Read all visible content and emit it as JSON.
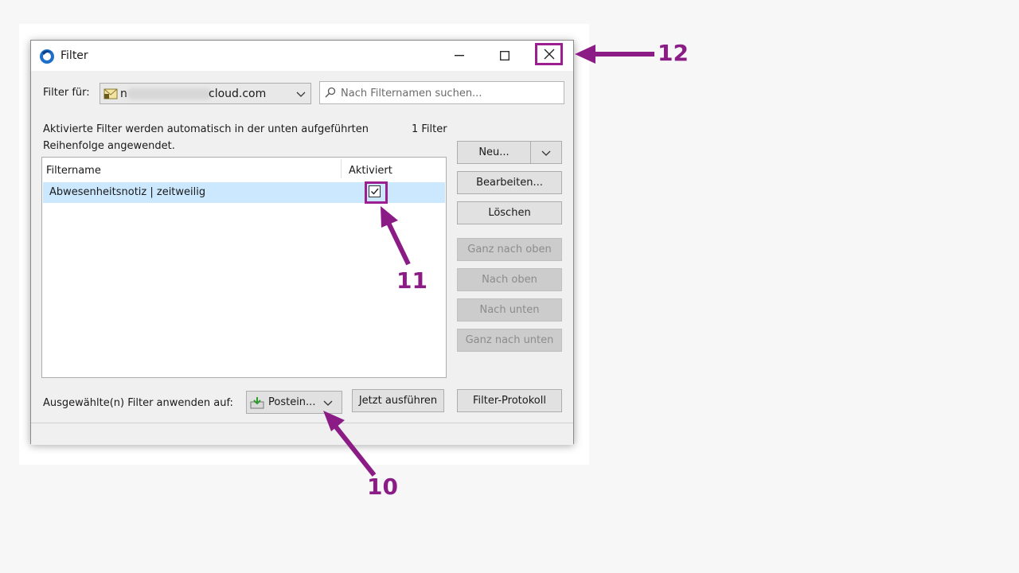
{
  "window": {
    "title": "Filter",
    "minimize_icon": "minimize-icon",
    "maximize_icon": "maximize-icon",
    "close_icon": "close-icon"
  },
  "filter_for": {
    "label": "Filter für:",
    "account_value": "n",
    "account_suffix": "cloud.com"
  },
  "search": {
    "placeholder": "Nach Filternamen suchen..."
  },
  "description": {
    "line1": "Aktivierte Filter werden automatisch in der unten aufgeführten",
    "line2": "Reihenfolge angewendet.",
    "count": "1 Filter"
  },
  "table": {
    "columns": [
      "Filtername",
      "Aktiviert"
    ],
    "rows": [
      {
        "name": "Abwesenheitsnotiz | zeitweilig",
        "enabled": true
      }
    ]
  },
  "buttons": {
    "new": "Neu...",
    "edit": "Bearbeiten...",
    "delete": "Löschen",
    "top": "Ganz nach oben",
    "up": "Nach oben",
    "down": "Nach unten",
    "bottom": "Ganz nach unten",
    "run_now": "Jetzt ausführen",
    "filter_log": "Filter-Protokoll"
  },
  "apply": {
    "label": "Ausgewählte(n) Filter anwenden auf:",
    "folder": "Postein..."
  },
  "annotations": [
    "10",
    "11",
    "12"
  ],
  "colors": {
    "accent": "#8b1c86",
    "selection": "#cce8ff"
  }
}
